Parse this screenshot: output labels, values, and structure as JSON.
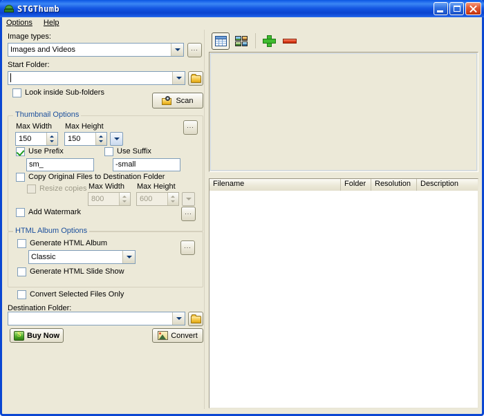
{
  "window": {
    "title": "STGThumb",
    "icon": "scanner-icon",
    "controls": {
      "minimize": "minimize-button",
      "maximize": "maximize-button",
      "close": "close-button"
    }
  },
  "menubar": {
    "items": [
      {
        "label": "Options",
        "accel": "O"
      },
      {
        "label": "Help",
        "accel": "H"
      }
    ]
  },
  "left_panel": {
    "image_types": {
      "label": "Image types:",
      "value": "Images and Videos",
      "options": [
        "Images and Videos"
      ],
      "browse_label": "..."
    },
    "start_folder": {
      "label": "Start Folder:",
      "value": "",
      "placeholder": "",
      "browse_icon": "folder-icon"
    },
    "look_subfolders": {
      "label": "Look inside Sub-folders",
      "checked": false
    },
    "scan_button": {
      "label": "Scan",
      "icon": "folder-search-icon"
    },
    "thumbnail_options": {
      "title": "Thumbnail Options",
      "settings_label": "...",
      "max_width": {
        "label": "Max Width",
        "value": "150"
      },
      "max_height": {
        "label": "Max Height",
        "value": "150"
      },
      "preset_dropdown": "chevron-down-icon",
      "use_prefix": {
        "label": "Use Prefix",
        "checked": true,
        "value": "sm_"
      },
      "use_suffix": {
        "label": "Use Suffix",
        "checked": false,
        "value": "-small"
      },
      "copy_originals": {
        "label": "Copy Original Files to Destination Folder",
        "checked": false
      },
      "resize_copies": {
        "label": "Resize copies",
        "checked": false,
        "enabled": false
      },
      "copy_max_width": {
        "label": "Max Width",
        "value": "800",
        "enabled": false
      },
      "copy_max_height": {
        "label": "Max Height",
        "value": "600",
        "enabled": false
      },
      "add_watermark": {
        "label": "Add Watermark",
        "checked": false
      },
      "watermark_settings_label": "..."
    },
    "html_album_options": {
      "title": "HTML Album Options",
      "generate_album": {
        "label": "Generate HTML Album",
        "checked": false
      },
      "template": {
        "value": "Classic",
        "options": [
          "Classic"
        ]
      },
      "generate_slideshow": {
        "label": "Generate HTML Slide Show",
        "checked": false
      },
      "settings_label": "..."
    },
    "convert_selected_only": {
      "label": "Convert Selected Files Only",
      "checked": false
    },
    "destination_folder": {
      "label": "Destination Folder:",
      "value": "",
      "browse_icon": "folder-icon"
    },
    "buy_now_button": {
      "label": "Buy Now",
      "icon": "money-icon"
    },
    "convert_button": {
      "label": "Convert",
      "icon": "picture-icon"
    }
  },
  "right_panel": {
    "toolbar": {
      "details_view": {
        "name": "details-view-icon",
        "pressed": true
      },
      "thumbnail_view": {
        "name": "thumbnail-view-icon",
        "pressed": false
      },
      "add": {
        "name": "plus-icon"
      },
      "remove": {
        "name": "minus-icon"
      }
    },
    "preview": {
      "content": ""
    },
    "file_list": {
      "columns": [
        "Filename",
        "Folder",
        "Resolution",
        "Description"
      ],
      "rows": []
    }
  },
  "colors": {
    "title_bar": "#0b56e0",
    "window_border": "#0a46d2",
    "face": "#ece9d8",
    "group_title": "#1b4f9c",
    "accent_green": "#3fbb2f",
    "accent_red": "#de3b18"
  }
}
